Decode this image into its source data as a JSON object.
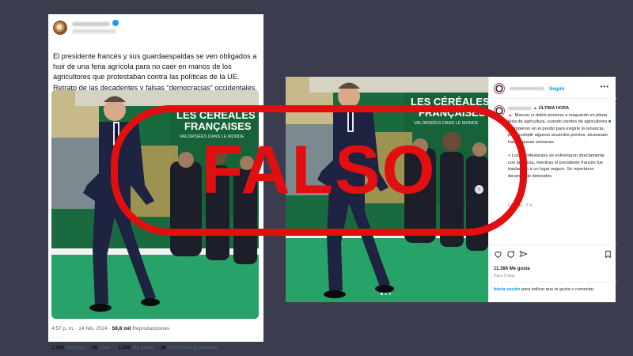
{
  "tweet": {
    "text": "El presidente francés y sus guardaespaldas se ven obligados a huir de una feria agrícola para no caer en manos de los agricultores que protestaban contra las políticas de la UE. Retrato de las decadentes y falsas “democracias” occidentales.",
    "photo_banner_line1": "LES CÉRÉALES",
    "photo_banner_line2": "FRANÇAISES",
    "photo_banner_line3": "VALORISÉES DANS LE MONDE",
    "time": "4:57 p. m.",
    "date": "24 feb. 2024",
    "views_count": "59,8 mil",
    "views_label": "Reproducciones",
    "reposts_count": "1.196",
    "reposts_label": "Reposts",
    "quotes_count": "55",
    "quotes_label": "Citas",
    "likes_count": "2.360",
    "likes_label": "Me gusta",
    "saved_count": "38",
    "saved_label": "Elementos guardados"
  },
  "instagram": {
    "follow_label": "Seguir",
    "more_label": "•••",
    "caption_head": "ÚLTIMA HORA",
    "caption_p1_a": "Macron ",
    "caption_p1_b": "cr debió ponerse a resguardo en plena feria de agricultura, cuando cientos de agricultores ",
    "caption_p1_c": " irrumpieron en el predio para exigirle la renuncia, por incumplir algunos acuerdos previos, alcanzado hace algunas semanas.",
    "caption_p2": "Los manifestantes se enfrentaron directamente con la policía, mientras el presidente francés fue trasladado a un lugar seguro. Se reportaron decenas de detenidos.",
    "edited_label": "Editado · 5 d",
    "likes_text": "11.384 Me gusta",
    "date_text": "Hace 5 días",
    "login_link": "Inicia sesión",
    "login_rest": " para indicar que te gusta o comentar.",
    "next_arrow": "›"
  },
  "stamp": {
    "label": "FALSO",
    "color": "#e10f0f"
  },
  "colors": {
    "background": "#3b3d4f",
    "instagram_link": "#0095f6",
    "twitter_verified": "#1d9bf0"
  },
  "icons": [
    "verified-badge-icon",
    "heart-icon",
    "comment-icon",
    "share-icon",
    "bookmark-icon",
    "siren-icon",
    "tractor-icon",
    "chevron-right-icon"
  ]
}
